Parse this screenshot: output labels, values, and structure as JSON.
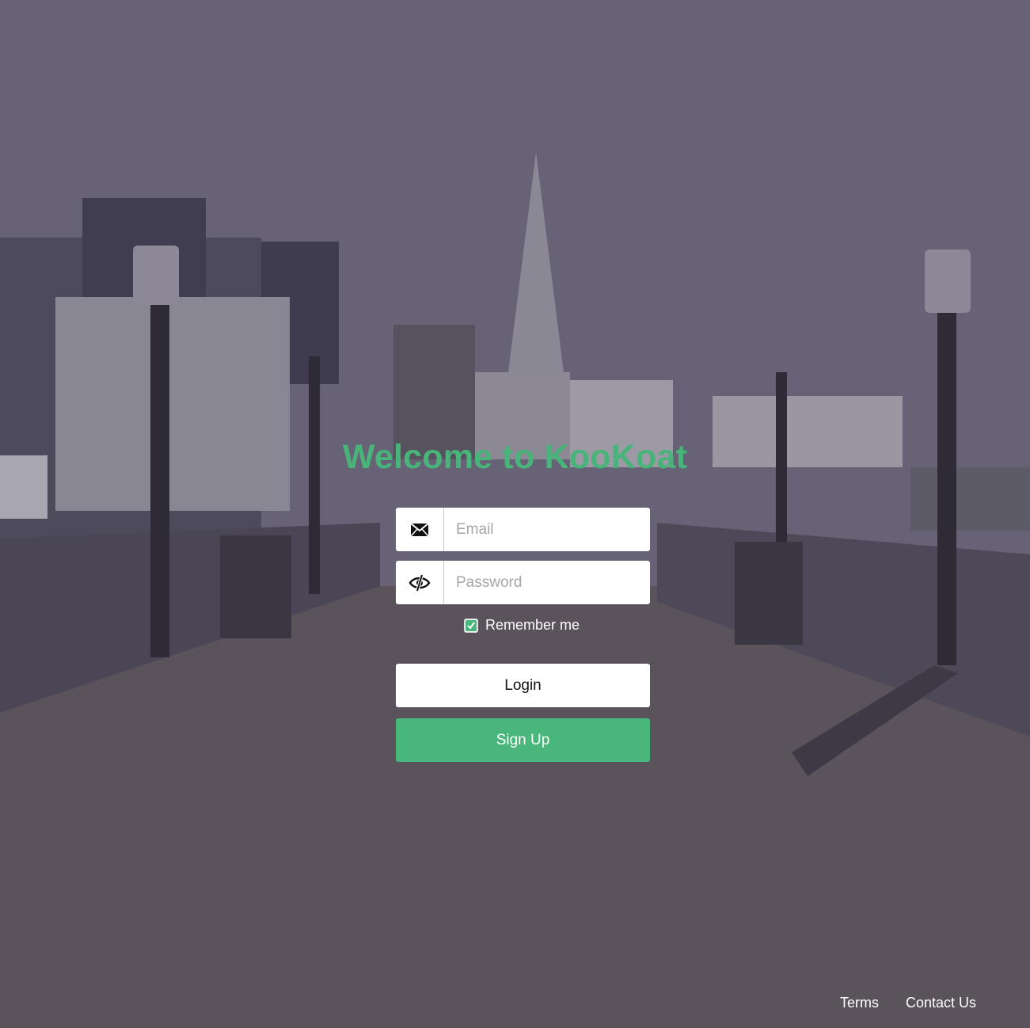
{
  "page": {
    "title": "Welcome to KooKoat",
    "accent_color": "#49b77c"
  },
  "form": {
    "email": {
      "placeholder": "Email",
      "value": "",
      "icon": "envelope-icon"
    },
    "password": {
      "placeholder": "Password",
      "value": "",
      "icon": "eye-slash-icon"
    },
    "remember_me": {
      "label": "Remember me",
      "checked": true
    },
    "login_label": "Login",
    "signup_label": "Sign Up"
  },
  "footer": {
    "terms_label": "Terms",
    "contact_label": "Contact Us"
  }
}
